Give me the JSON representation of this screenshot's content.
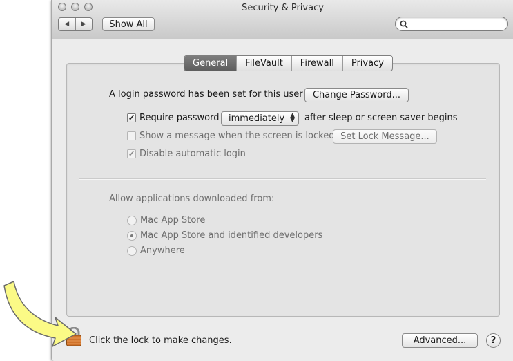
{
  "window": {
    "title": "Security & Privacy"
  },
  "toolbar": {
    "back_icon": "◀",
    "forward_icon": "▶",
    "show_all_label": "Show All",
    "search_value": "",
    "search_placeholder": ""
  },
  "tabs": [
    {
      "label": "General",
      "selected": true
    },
    {
      "label": "FileVault",
      "selected": false
    },
    {
      "label": "Firewall",
      "selected": false
    },
    {
      "label": "Privacy",
      "selected": false
    }
  ],
  "general": {
    "login_password_text": "A login password has been set for this user",
    "change_password_label": "Change Password...",
    "require_password": {
      "label": "Require password",
      "checked": true
    },
    "require_password_select": "immediately",
    "after_sleep_text": "after sleep or screen saver begins",
    "show_message": {
      "label": "Show a message when the screen is locked",
      "checked": false
    },
    "set_lock_message_label": "Set Lock Message...",
    "disable_auto_login": {
      "label": "Disable automatic login",
      "checked": true
    },
    "allow_apps_heading": "Allow applications downloaded from:",
    "app_sources": [
      {
        "label": "Mac App Store",
        "selected": false
      },
      {
        "label": "Mac App Store and identified developers",
        "selected": true
      },
      {
        "label": "Anywhere",
        "selected": false
      }
    ]
  },
  "footer": {
    "lock_text": "Click the lock to make changes.",
    "advanced_label": "Advanced...",
    "help_label": "?"
  },
  "colors": {
    "arrow_fill": "#fbfa86",
    "arrow_stroke": "#6b6b6b",
    "lock_body": "#d0722a",
    "active_tab": "#6a6a6a"
  }
}
